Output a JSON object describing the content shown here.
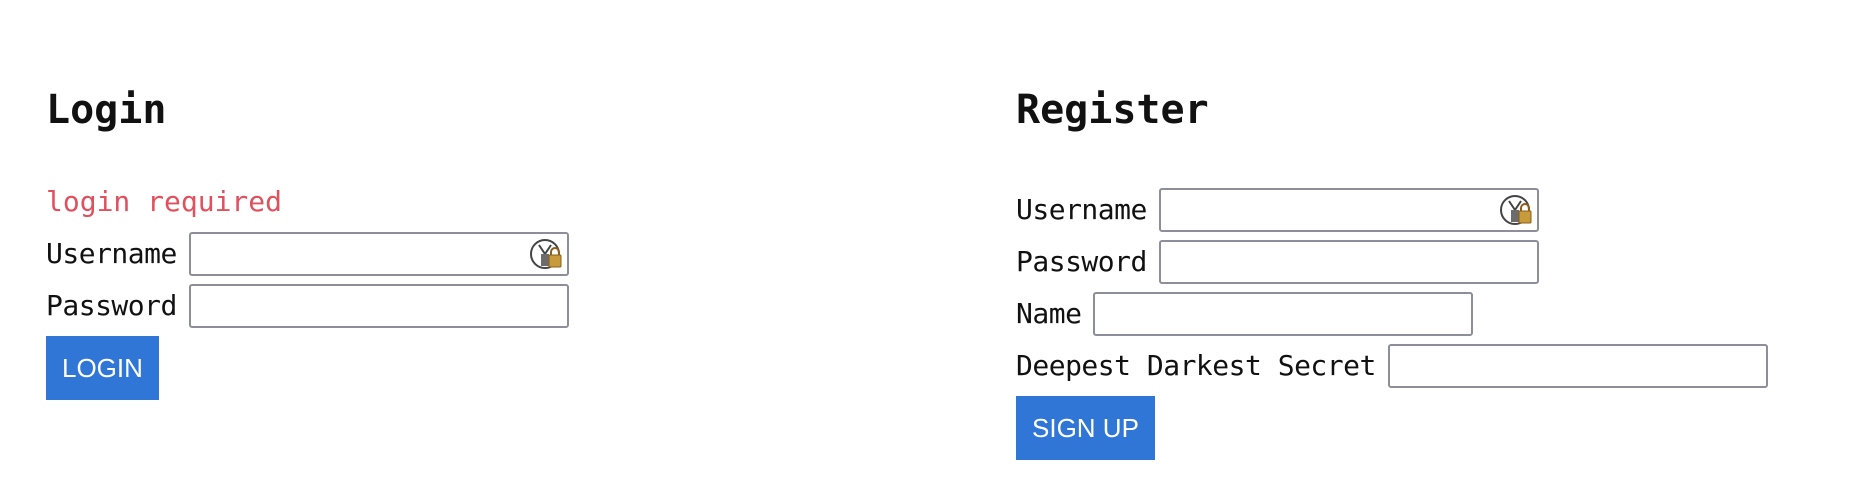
{
  "login": {
    "title": "Login",
    "error": "login required",
    "username_label": "Username",
    "password_label": "Password",
    "username_value": "",
    "password_value": "",
    "button_label": "LOGIN"
  },
  "register": {
    "title": "Register",
    "username_label": "Username",
    "password_label": "Password",
    "name_label": "Name",
    "secret_label": "Deepest Darkest Secret",
    "username_value": "",
    "password_value": "",
    "name_value": "",
    "secret_value": "",
    "button_label": "SIGN UP"
  },
  "icons": {
    "password_manager": "keepass-lock-icon"
  },
  "colors": {
    "error": "#e0505e",
    "button": "#2f76d6",
    "input_border": "#8e8e9a"
  }
}
